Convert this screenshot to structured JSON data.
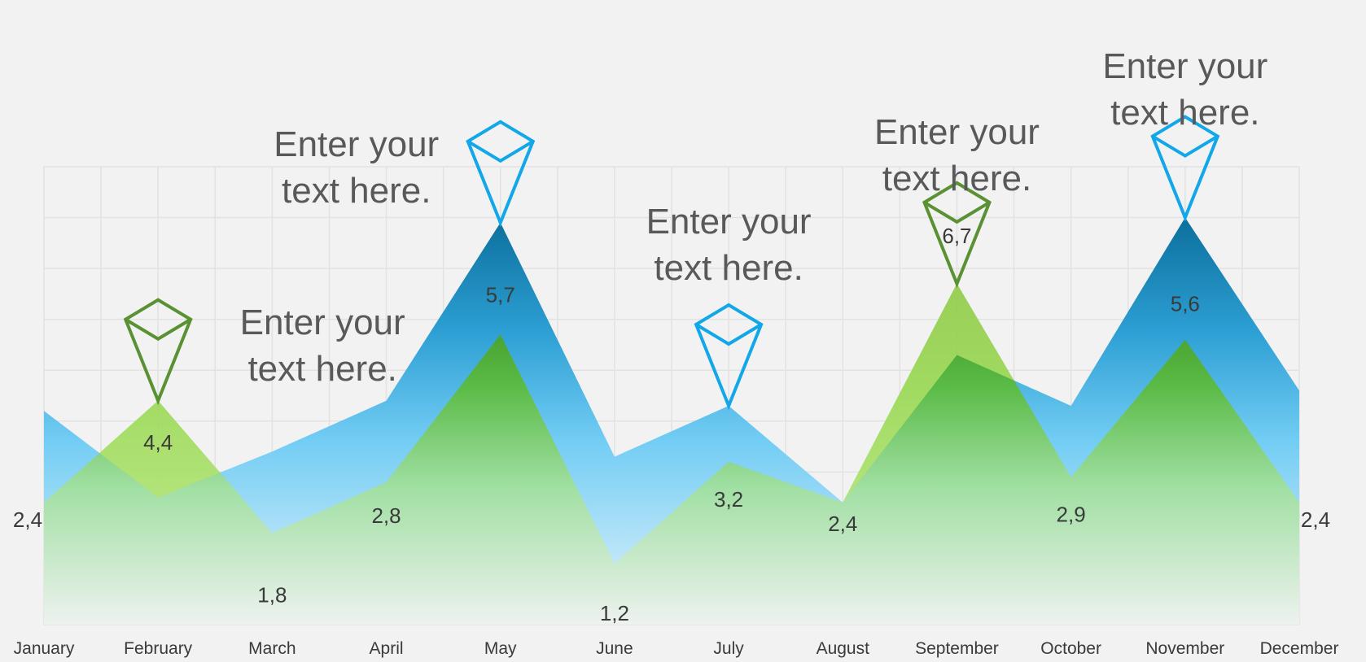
{
  "chart_data": {
    "type": "area",
    "categories": [
      "January",
      "February",
      "March",
      "April",
      "May",
      "June",
      "July",
      "August",
      "September",
      "October",
      "November",
      "December"
    ],
    "series": [
      {
        "values": [
          4.2,
          2.5,
          3.4,
          4.4,
          7.9,
          3.3,
          4.3,
          2.4,
          5.3,
          4.3,
          8.0,
          4.6
        ],
        "color": "#1ba1e2"
      },
      {
        "values": [
          2.4,
          4.4,
          1.8,
          2.8,
          5.7,
          1.2,
          3.2,
          2.4,
          6.7,
          2.9,
          5.6,
          2.4
        ],
        "color": "#4aa82b"
      }
    ],
    "data_labels": [
      "2,4",
      "4,4",
      "1,8",
      "2,8",
      "5,7",
      "1,2",
      "3,2",
      "2,4",
      "6,7",
      "2,9",
      "5,6",
      "2,4"
    ],
    "ylim": [
      0,
      9
    ],
    "grid": true,
    "markers": [
      {
        "category_index": 1,
        "color": "#5a9132",
        "series": 1
      },
      {
        "category_index": 4,
        "color": "#11a7e8",
        "series": 0
      },
      {
        "category_index": 6,
        "color": "#11a7e8",
        "series": 0
      },
      {
        "category_index": 8,
        "color": "#5a9132",
        "series": 1
      },
      {
        "category_index": 10,
        "color": "#11a7e8",
        "series": 0
      }
    ]
  },
  "callouts": [
    {
      "text": "Enter your\ntext here."
    },
    {
      "text": "Enter your\ntext here."
    },
    {
      "text": "Enter your\ntext here."
    },
    {
      "text": "Enter your\ntext here."
    },
    {
      "text": "Enter your\ntext here."
    }
  ]
}
